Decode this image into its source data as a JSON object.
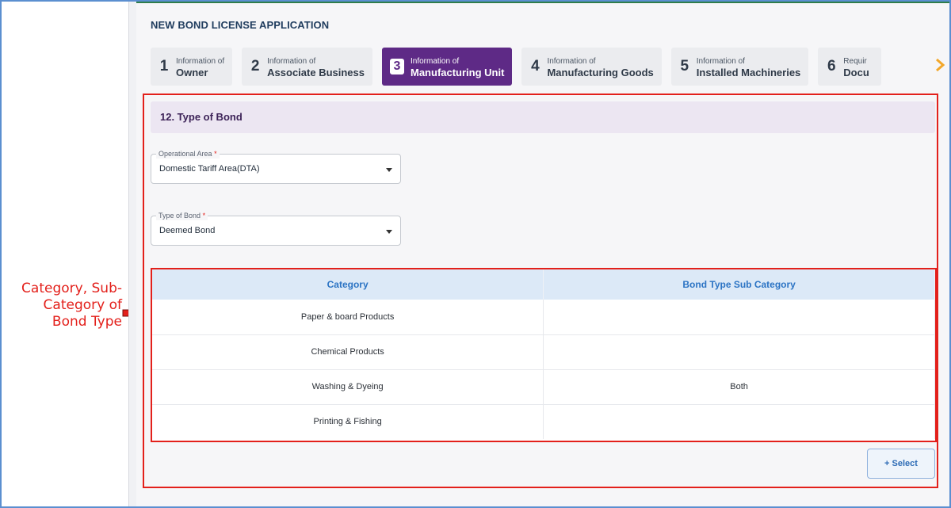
{
  "annotation": {
    "text": "Category, Sub-Category of Bond Type"
  },
  "page": {
    "title": "NEW BOND LICENSE APPLICATION"
  },
  "steps": [
    {
      "number": "1",
      "small": "Information of",
      "label": "Owner",
      "active": false
    },
    {
      "number": "2",
      "small": "Information of",
      "label": "Associate Business",
      "active": false
    },
    {
      "number": "3",
      "small": "Information of",
      "label": "Manufacturing Unit",
      "active": true
    },
    {
      "number": "4",
      "small": "Information of",
      "label": "Manufacturing Goods",
      "active": false
    },
    {
      "number": "5",
      "small": "Information of",
      "label": "Installed Machineries",
      "active": false
    },
    {
      "number": "6",
      "small": "Requir",
      "label": "Docu",
      "active": false
    }
  ],
  "section": {
    "title": "12. Type of Bond"
  },
  "fields": {
    "operational_area": {
      "label": "Operational Area",
      "required": "*",
      "value": "Domestic Tariff Area(DTA)"
    },
    "type_of_bond": {
      "label": "Type of Bond",
      "required": "*",
      "value": "Deemed Bond"
    }
  },
  "table": {
    "headers": [
      "Category",
      "Bond Type Sub Category"
    ],
    "rows": [
      [
        "Paper & board Products",
        ""
      ],
      [
        "Chemical Products",
        ""
      ],
      [
        "Washing & Dyeing",
        "Both"
      ],
      [
        "Printing & Fishing",
        ""
      ]
    ]
  },
  "actions": {
    "select_label": "+ Select"
  },
  "colors": {
    "accent": "#5e2a86",
    "annotation": "#e3201b",
    "header_text": "#2c74c4"
  }
}
